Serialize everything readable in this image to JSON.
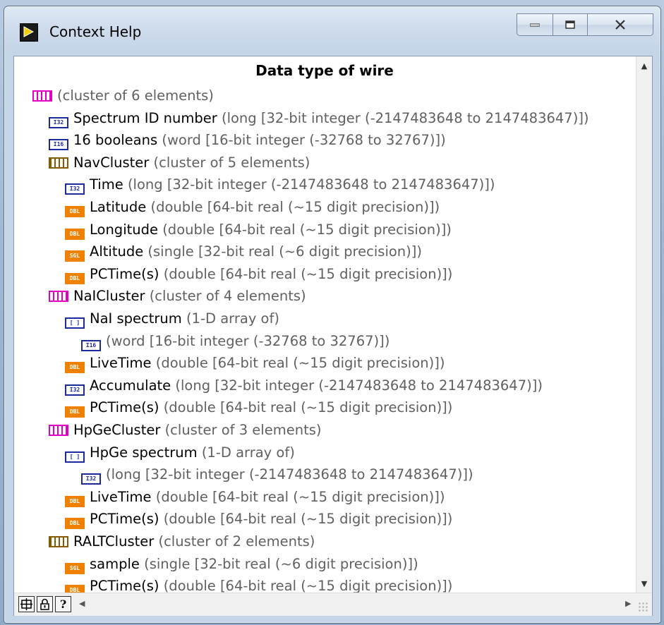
{
  "window": {
    "title": "Context Help"
  },
  "help": {
    "heading": "Data type of wire",
    "rows": [
      {
        "indent": 0,
        "icon": "cluster-pink-icon",
        "tag": "",
        "name": "",
        "desc": "(cluster of 6 elements)"
      },
      {
        "indent": 1,
        "icon": "i32-icon",
        "tag": "I32",
        "name": "Spectrum ID number",
        "desc": "(long [32-bit integer (-2147483648 to 2147483647)])"
      },
      {
        "indent": 1,
        "icon": "i16-icon",
        "tag": "I16",
        "name": "16 booleans",
        "desc": "(word [16-bit integer (-32768 to 32767)])"
      },
      {
        "indent": 1,
        "icon": "cluster-brown-icon",
        "tag": "",
        "name": "NavCluster",
        "desc": "(cluster of 5 elements)"
      },
      {
        "indent": 2,
        "icon": "i32-icon",
        "tag": "I32",
        "name": "Time",
        "desc": "(long [32-bit integer (-2147483648 to 2147483647)])"
      },
      {
        "indent": 2,
        "icon": "dbl-icon",
        "tag": "DBL",
        "name": "Latitude",
        "desc": "(double [64-bit real (~15 digit precision)])"
      },
      {
        "indent": 2,
        "icon": "dbl-icon",
        "tag": "DBL",
        "name": "Longitude",
        "desc": "(double [64-bit real (~15 digit precision)])"
      },
      {
        "indent": 2,
        "icon": "sgl-icon",
        "tag": "SGL",
        "name": "Altitude",
        "desc": "(single [32-bit real (~6 digit precision)])"
      },
      {
        "indent": 2,
        "icon": "dbl-icon",
        "tag": "DBL",
        "name": "PCTime(s)",
        "desc": "(double [64-bit real (~15 digit precision)])"
      },
      {
        "indent": 1,
        "icon": "cluster-pink-icon",
        "tag": "",
        "name": "NaICluster",
        "desc": "(cluster of 4 elements)"
      },
      {
        "indent": 2,
        "icon": "array-icon",
        "tag": "[ ]",
        "name": "NaI spectrum",
        "desc": "(1-D array of)"
      },
      {
        "indent": 3,
        "icon": "i16-icon",
        "tag": "I16",
        "name": "",
        "desc": "(word [16-bit integer (-32768 to 32767)])"
      },
      {
        "indent": 2,
        "icon": "dbl-icon",
        "tag": "DBL",
        "name": "LiveTime",
        "desc": "(double [64-bit real (~15 digit precision)])"
      },
      {
        "indent": 2,
        "icon": "i32-icon",
        "tag": "I32",
        "name": "Accumulate",
        "desc": "(long [32-bit integer (-2147483648 to 2147483647)])"
      },
      {
        "indent": 2,
        "icon": "dbl-icon",
        "tag": "DBL",
        "name": "PCTime(s)",
        "desc": "(double [64-bit real (~15 digit precision)])"
      },
      {
        "indent": 1,
        "icon": "cluster-pink-icon",
        "tag": "",
        "name": "HpGeCluster",
        "desc": "(cluster of 3 elements)"
      },
      {
        "indent": 2,
        "icon": "array-icon",
        "tag": "[ ]",
        "name": "HpGe spectrum",
        "desc": "(1-D array of)"
      },
      {
        "indent": 3,
        "icon": "i32-icon",
        "tag": "I32",
        "name": "",
        "desc": "(long [32-bit integer (-2147483648 to 2147483647)])"
      },
      {
        "indent": 2,
        "icon": "dbl-icon",
        "tag": "DBL",
        "name": "LiveTime",
        "desc": "(double [64-bit real (~15 digit precision)])"
      },
      {
        "indent": 2,
        "icon": "dbl-icon",
        "tag": "DBL",
        "name": "PCTime(s)",
        "desc": "(double [64-bit real (~15 digit precision)])"
      },
      {
        "indent": 1,
        "icon": "cluster-brown-icon",
        "tag": "",
        "name": "RALTCluster",
        "desc": "(cluster of 2 elements)"
      },
      {
        "indent": 2,
        "icon": "sgl-icon",
        "tag": "SGL",
        "name": "sample",
        "desc": "(single [32-bit real (~6 digit precision)])"
      },
      {
        "indent": 2,
        "icon": "dbl-icon",
        "tag": "DBL",
        "name": "PCTime(s)",
        "desc": "(double [64-bit real (~15 digit precision)])"
      }
    ]
  },
  "colors": {
    "cluster_pink": "#e000c8",
    "cluster_brown": "#8a5a00",
    "integer_blue": "#1c2aa0",
    "float_orange": "#f08000",
    "desc_gray": "#606060"
  },
  "toolbar": {
    "buttons": [
      "show-optional-terminals-icon",
      "lock-icon",
      "detailed-help-icon"
    ]
  }
}
